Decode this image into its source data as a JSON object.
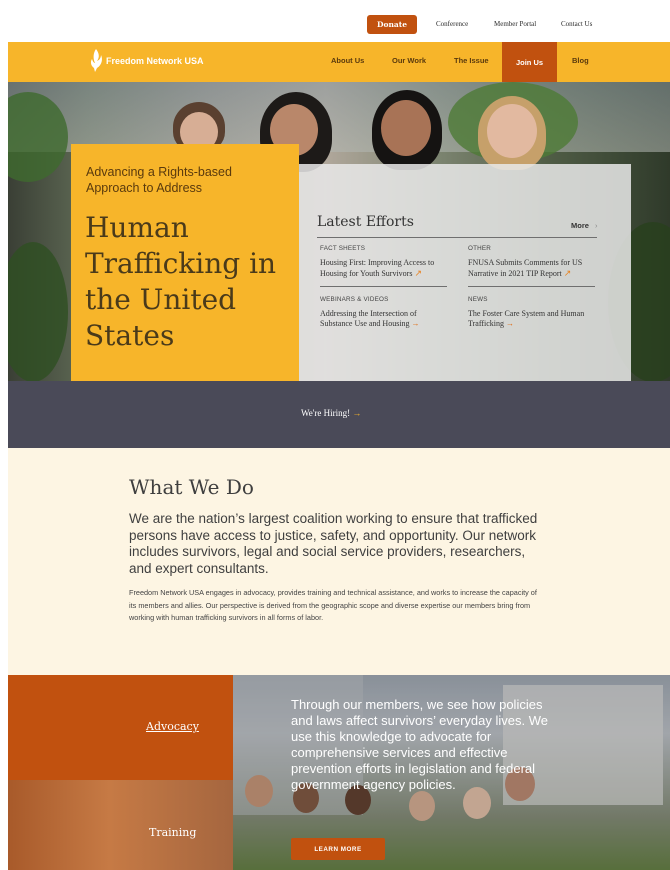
{
  "utility_nav": {
    "donate": "Donate",
    "conference": "Conference",
    "member_portal": "Member Portal",
    "contact": "Contact Us"
  },
  "main_nav": {
    "logo_text": "Freedom Network USA",
    "about": "About Us",
    "our_work": "Our Work",
    "the_issue": "The Issue",
    "join": "Join Us",
    "blog": "Blog"
  },
  "hero": {
    "kicker": "Advancing a Rights-based Approach to Address",
    "title": "Human Trafficking in the United States"
  },
  "latest_efforts": {
    "title": "Latest Efforts",
    "more": "More",
    "items": [
      {
        "category": "FACT SHEETS",
        "text": "Housing First: Improving Access to Housing for Youth Survivors"
      },
      {
        "category": "OTHER",
        "text": "FNUSA Submits Comments for US Narrative in 2021 TIP Report"
      },
      {
        "category": "WEBINARS & VIDEOS",
        "text": "Addressing the Intersection of Substance Use and Housing"
      },
      {
        "category": "NEWS",
        "text": "The Foster Care System and Human Trafficking"
      }
    ]
  },
  "hiring": {
    "text": "We're Hiring!"
  },
  "what_we_do": {
    "title": "What We Do",
    "lead": "We are the nation’s largest coalition working to ensure that trafficked persons have access to justice, safety, and opportunity. Our network includes survivors, legal and social service providers, researchers, and expert consultants.",
    "body": "Freedom Network USA engages in advocacy, provides training and technical assistance, and works to increase the capacity of its members and allies. Our perspective is derived from the geographic scope and diverse expertise our members bring from working with human trafficking survivors in all forms of labor."
  },
  "panels": {
    "advocacy_tab": "Advocacy",
    "training_tab": "Training",
    "advocacy_text": "Through our members, we see how policies and laws affect survivors’ everyday lives. We use this knowledge to advocate for comprehensive services and effective prevention efforts in legislation and federal government agency policies.",
    "learn_more": "LEARN MORE"
  },
  "colors": {
    "brand_yellow": "#f7b52a",
    "brand_orange": "#c1510f",
    "hiring_band": "#4a4a58",
    "cream": "#fdf5e3"
  }
}
